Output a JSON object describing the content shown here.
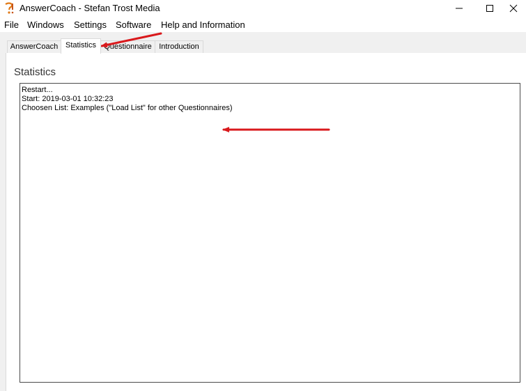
{
  "window": {
    "title": "AnswerCoach - Stefan Trost Media",
    "app_icon": "answercoach-icon",
    "controls": [
      "minimize-icon",
      "maximize-icon",
      "close-icon"
    ]
  },
  "menu": {
    "items": [
      "File",
      "Windows",
      "Settings",
      "Software",
      "Help and Information"
    ]
  },
  "tabs": {
    "items": [
      "AnswerCoach",
      "Statistics",
      "Questionnaire",
      "Introduction"
    ],
    "active": "Statistics"
  },
  "statistics": {
    "heading": "Statistics",
    "log_lines": [
      "Restart...",
      "Start: 2019-03-01 10:32:23",
      "Choosen List: Examples (\"Load List\" for other Questionnaires)"
    ]
  },
  "annotations": {
    "arrow_color": "#d9191c"
  }
}
